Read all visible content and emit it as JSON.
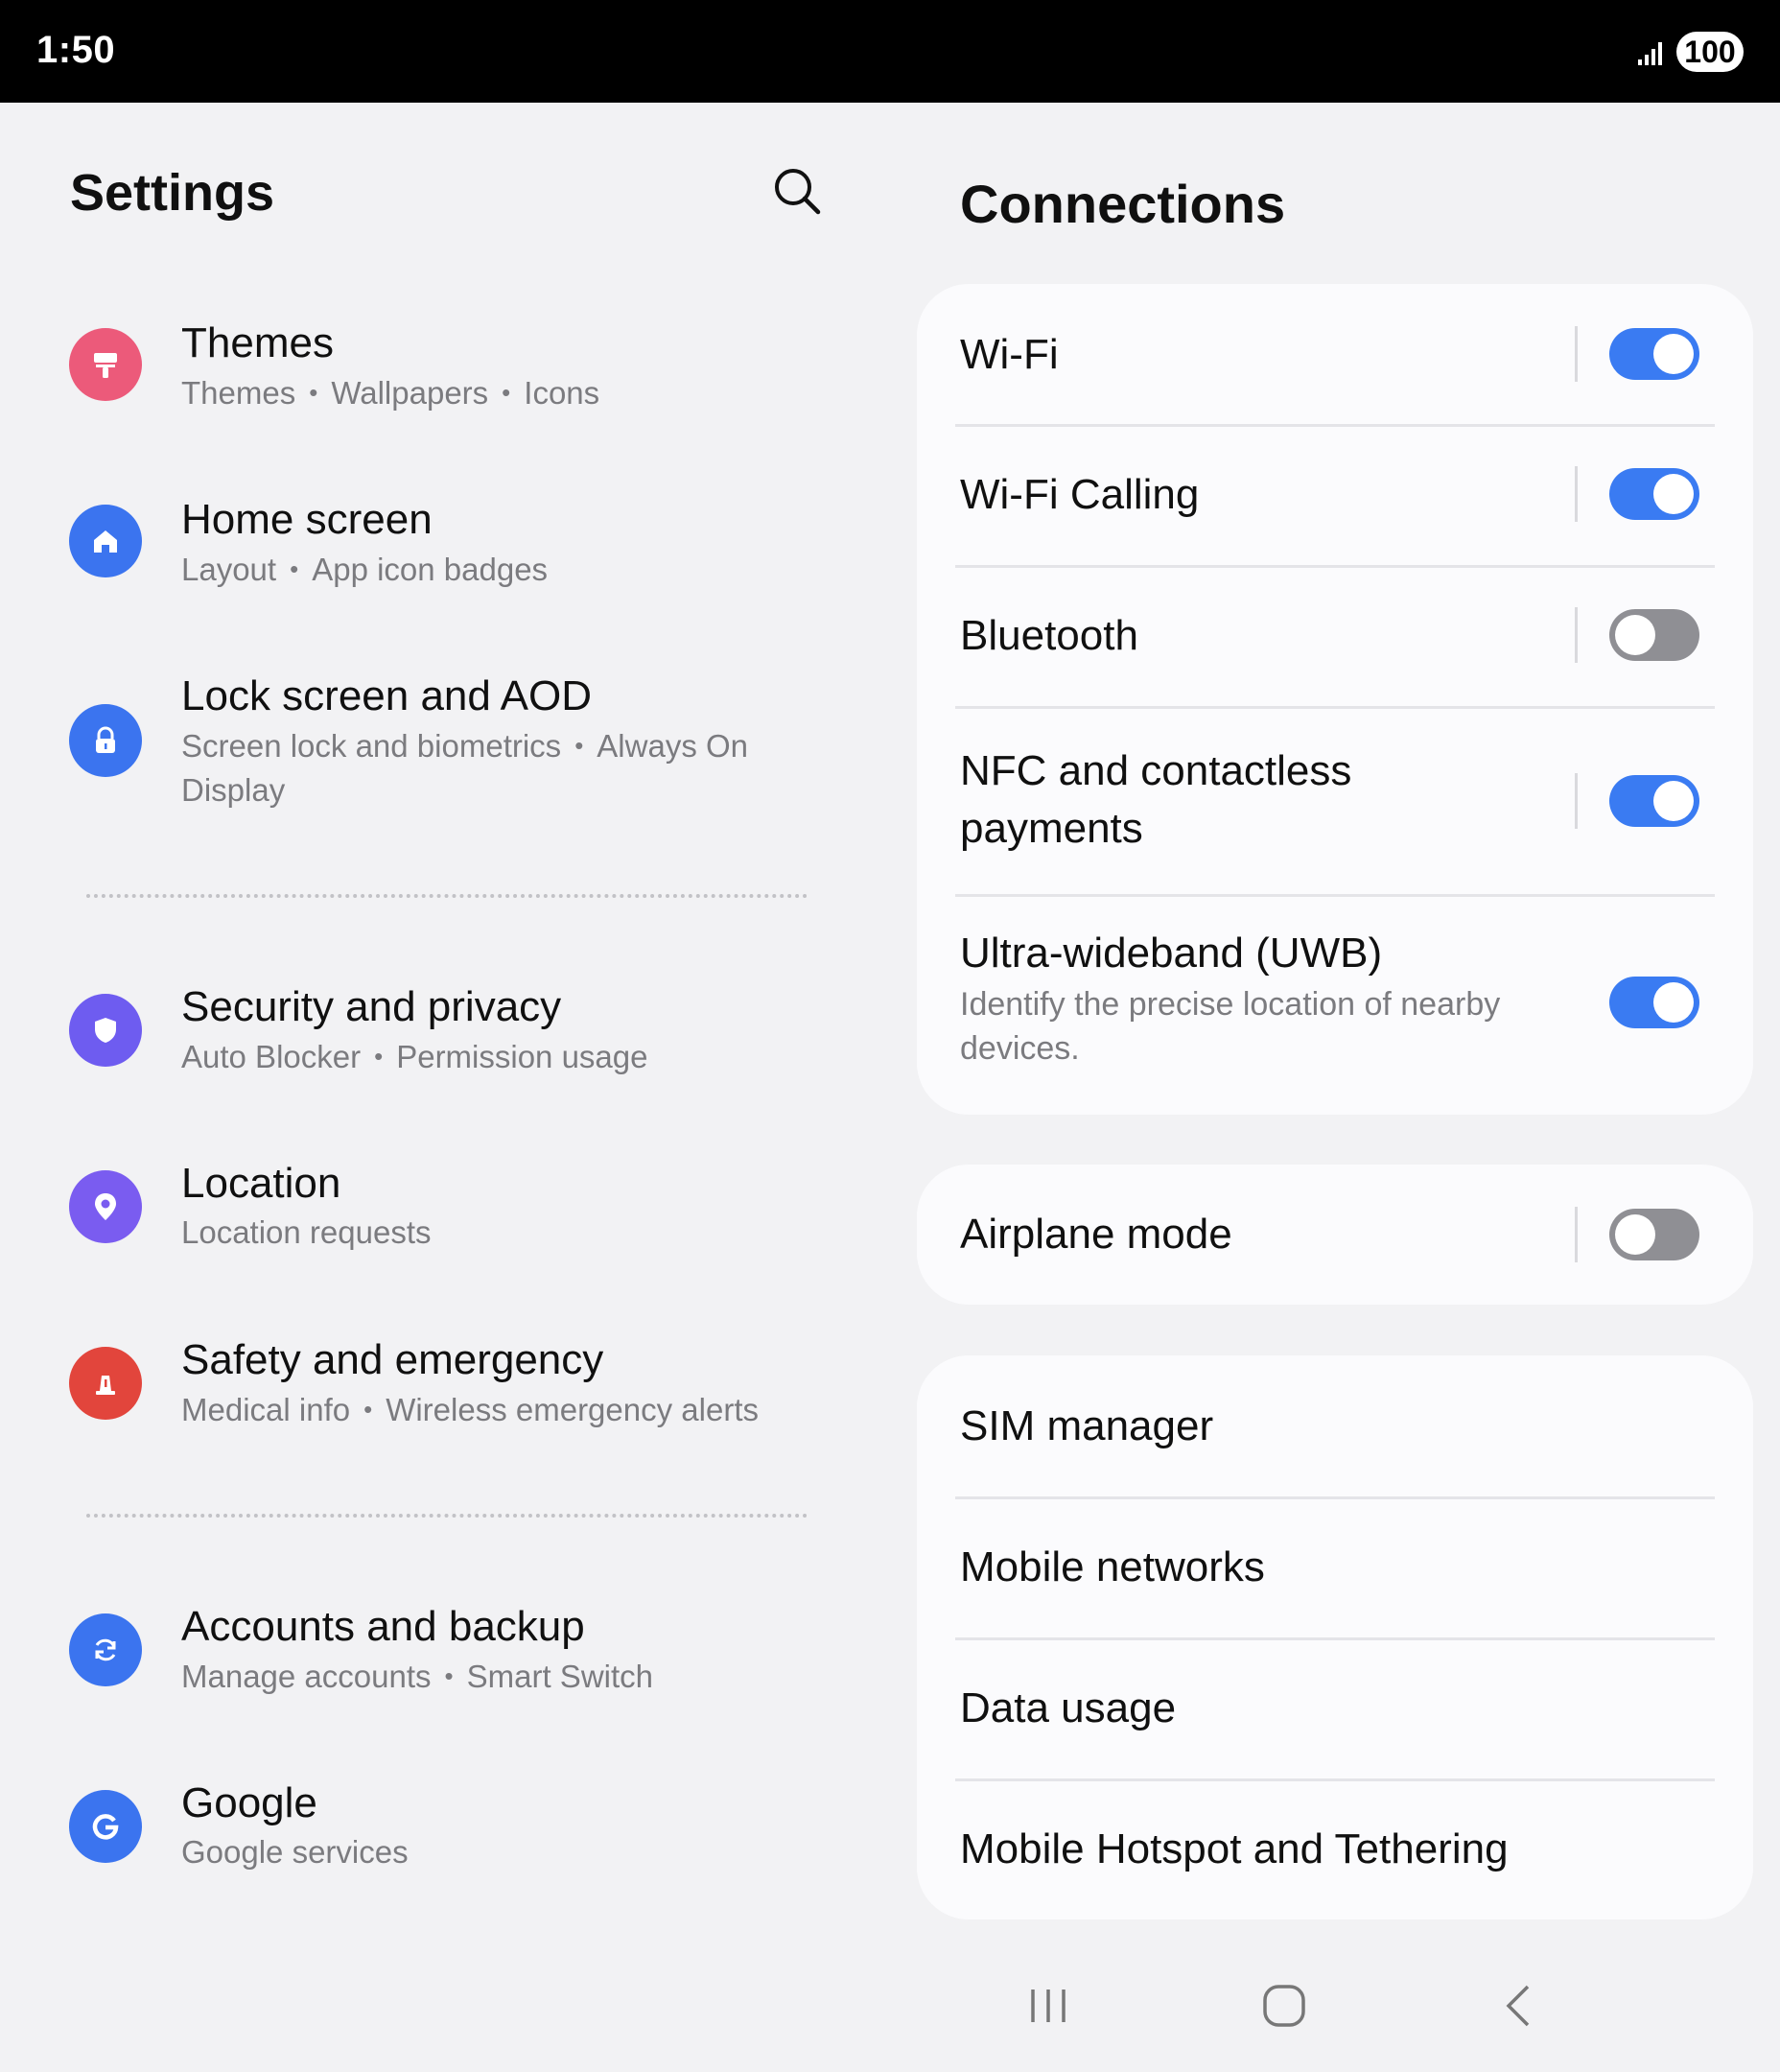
{
  "status_bar": {
    "time": "1:50",
    "battery": "100",
    "signal_icon": "signal-bars-icon"
  },
  "left": {
    "title": "Settings",
    "search_icon": "search-icon",
    "items": [
      {
        "title": "Themes",
        "subs": [
          "Themes",
          "Wallpapers",
          "Icons"
        ],
        "icon": "paint-roller-icon",
        "color": "#ec5a7a"
      },
      {
        "title": "Home screen",
        "subs": [
          "Layout",
          "App icon badges"
        ],
        "icon": "home-icon",
        "color": "#3b74ef"
      },
      {
        "title": "Lock screen and AOD",
        "subs_text": "Screen lock and biometrics",
        "subs_text2": "Always On",
        "subs_text3": "Display",
        "icon": "lock-icon",
        "color": "#3b74ef"
      },
      {
        "title": "Security and privacy",
        "subs": [
          "Auto Blocker",
          "Permission usage"
        ],
        "icon": "shield-icon",
        "color": "#6e5cf0"
      },
      {
        "title": "Location",
        "subs": [
          "Location requests"
        ],
        "icon": "location-pin-icon",
        "color": "#7a5cf0"
      },
      {
        "title": "Safety and emergency",
        "subs": [
          "Medical info",
          "Wireless emergency alerts"
        ],
        "icon": "emergency-icon",
        "color": "#e2453c"
      },
      {
        "title": "Accounts and backup",
        "subs": [
          "Manage accounts",
          "Smart Switch"
        ],
        "icon": "sync-icon",
        "color": "#3b74ef"
      },
      {
        "title": "Google",
        "subs": [
          "Google services"
        ],
        "icon": "google-icon",
        "color": "#3b74ef"
      }
    ]
  },
  "right": {
    "title": "Connections",
    "card1": [
      {
        "label": "Wi-Fi",
        "toggle": true
      },
      {
        "label": "Wi-Fi Calling",
        "toggle": true
      },
      {
        "label": "Bluetooth",
        "toggle": false
      },
      {
        "label_line1": "NFC and contactless",
        "label_line2": "payments",
        "toggle": true
      },
      {
        "label": "Ultra-wideband (UWB)",
        "sub_line1": "Identify the precise location of nearby",
        "sub_line2": "devices.",
        "toggle": true
      }
    ],
    "card2": {
      "label": "Airplane mode",
      "toggle": false
    },
    "card3": [
      "SIM manager",
      "Mobile networks",
      "Data usage",
      "Mobile Hotspot and Tethering"
    ]
  },
  "nav": {
    "recents_icon": "recents-icon",
    "home_icon": "home-button-icon",
    "back_icon": "back-icon"
  },
  "colors": {
    "accent": "#3a7bf2",
    "toggle_off": "#8f8f94",
    "background": "#f2f2f4",
    "card": "#fbfbfd"
  }
}
